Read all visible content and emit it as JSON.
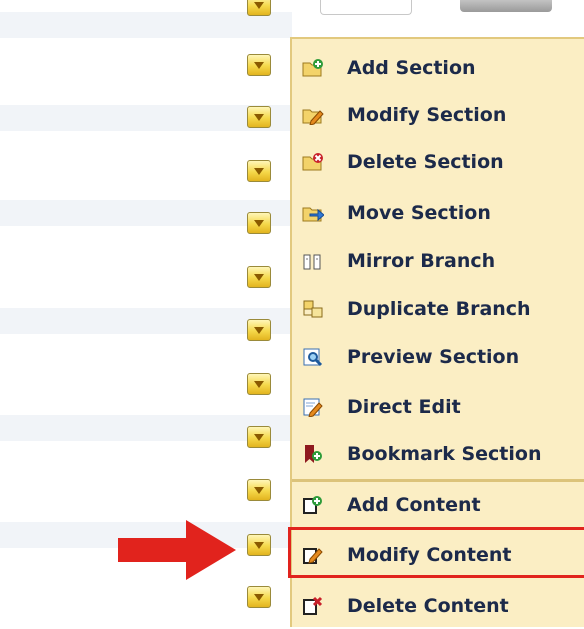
{
  "menu": {
    "items": [
      {
        "name": "add-section",
        "label": "Add Section",
        "icon": "folder-add-icon"
      },
      {
        "name": "modify-section",
        "label": "Modify Section",
        "icon": "folder-edit-icon"
      },
      {
        "name": "delete-section",
        "label": "Delete Section",
        "icon": "folder-delete-icon"
      },
      {
        "name": "move-section",
        "label": "Move Section",
        "icon": "folder-move-icon"
      },
      {
        "name": "mirror-branch",
        "label": "Mirror Branch",
        "icon": "mirror-icon"
      },
      {
        "name": "duplicate-branch",
        "label": "Duplicate Branch",
        "icon": "duplicate-icon"
      },
      {
        "name": "preview-section",
        "label": "Preview Section",
        "icon": "preview-icon"
      },
      {
        "name": "direct-edit",
        "label": "Direct Edit",
        "icon": "edit-page-icon"
      },
      {
        "name": "bookmark-section",
        "label": "Bookmark Section",
        "icon": "bookmark-icon"
      },
      {
        "name": "add-content",
        "label": "Add Content",
        "icon": "content-add-icon"
      },
      {
        "name": "modify-content",
        "label": "Modify Content",
        "icon": "content-edit-icon"
      },
      {
        "name": "delete-content",
        "label": "Delete Content",
        "icon": "content-delete-icon"
      }
    ],
    "highlighted_item": "Modify Content"
  },
  "colors": {
    "menu_bg": "#fbeec4",
    "highlight": "#e1231d",
    "arrow": "#e1231d",
    "label_text": "#1c2a4a"
  }
}
